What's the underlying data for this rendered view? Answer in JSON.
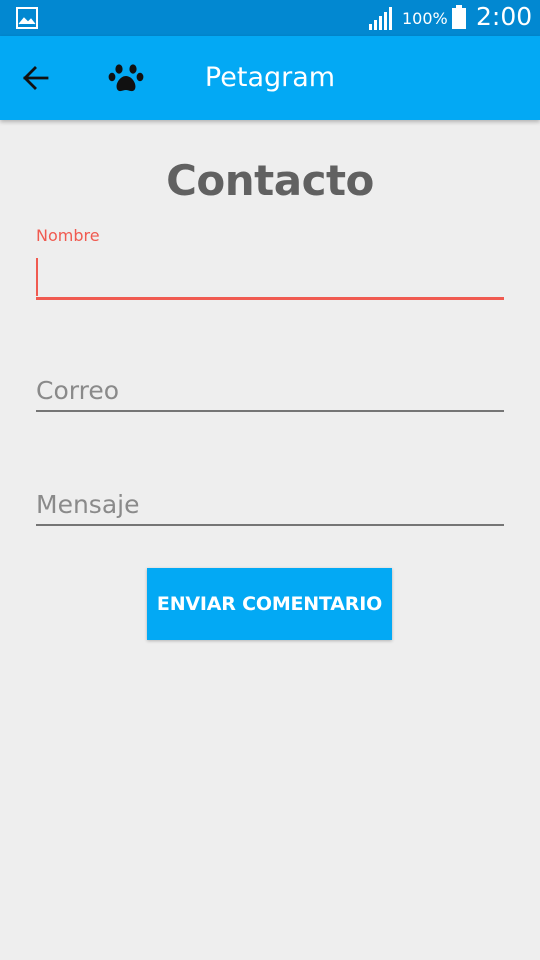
{
  "status_bar": {
    "battery_text": "100%",
    "time": "2:00",
    "icons": [
      "gallery-icon",
      "signal-icon",
      "battery-icon"
    ]
  },
  "app_bar": {
    "title": "Petagram",
    "icons": [
      "back-arrow-icon",
      "paw-icon"
    ]
  },
  "contact": {
    "title": "Contacto",
    "name_field": {
      "label": "Nombre",
      "value": ""
    },
    "email_field": {
      "placeholder": "Correo",
      "value": ""
    },
    "message_field": {
      "placeholder": "Mensaje",
      "value": ""
    },
    "send_label": "ENVIAR COMENTARIO"
  },
  "colors": {
    "status_bar": "#0288D1",
    "app_bar": "#03A9F4",
    "accent": "#F05A50",
    "background": "#EEEEEE",
    "title_text": "#616161"
  }
}
